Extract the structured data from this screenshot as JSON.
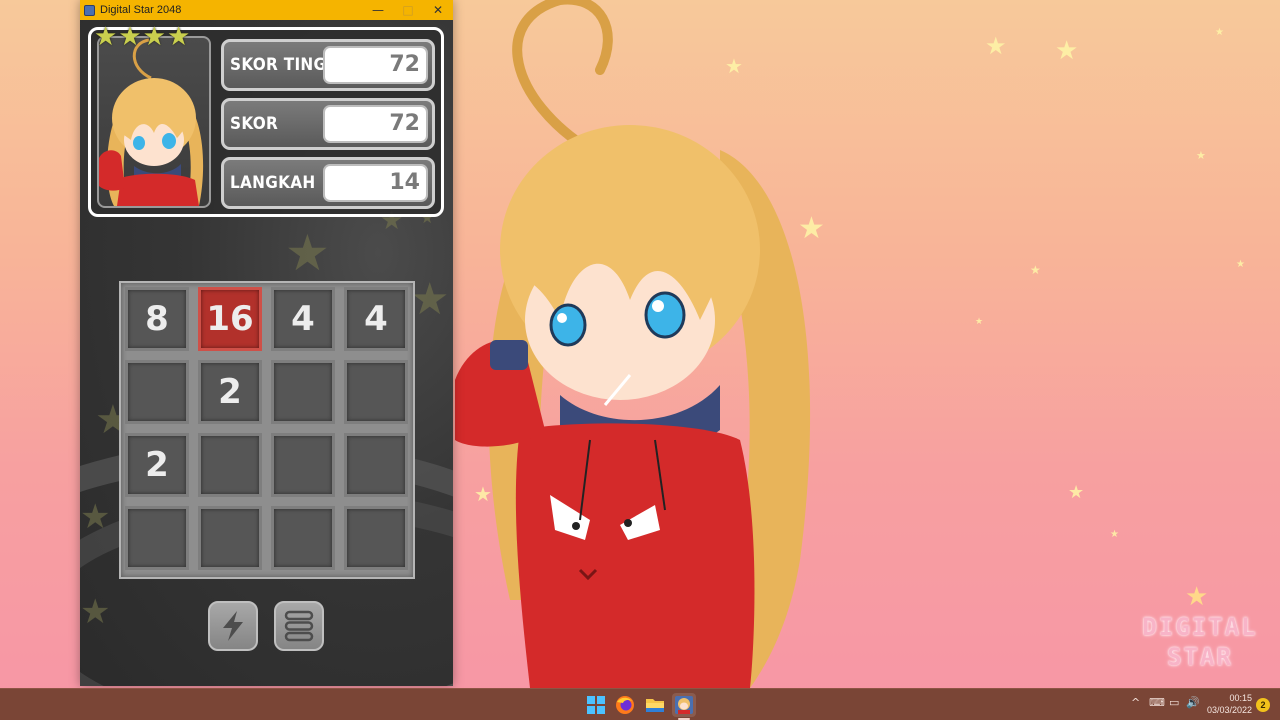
{
  "window": {
    "title": "Digital Star 2048",
    "minimize_glyph": "—",
    "maximize_glyph": "□",
    "close_glyph": "✕"
  },
  "stats": {
    "high_score": {
      "label": "SKOR TINGGI",
      "value": "72"
    },
    "score": {
      "label": "SKOR",
      "value": "72"
    },
    "steps": {
      "label": "LANGKAH",
      "value": "14"
    }
  },
  "rank_stars": 4,
  "board": [
    [
      "8",
      "16",
      "4",
      "4"
    ],
    [
      "",
      "2",
      "",
      ""
    ],
    [
      "2",
      "",
      "",
      ""
    ],
    [
      "",
      "",
      "",
      ""
    ]
  ],
  "buttons": {
    "lightning_icon": "lightning-icon",
    "menu_icon": "menu-icon"
  },
  "desktop_logo": {
    "line1": "DIGITAL",
    "line2": "STAR"
  },
  "taskbar": {
    "time": "00:15",
    "date": "03/03/2022",
    "notification_count": "2"
  },
  "colors": {
    "title_bar": "#f5b400",
    "highlight_tile": "#b2312b",
    "taskbar": "#7a4536"
  }
}
